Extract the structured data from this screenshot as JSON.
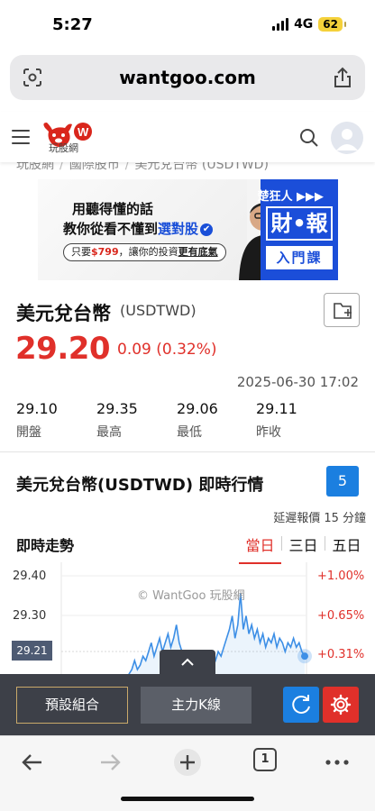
{
  "status_bar": {
    "time": "5:27",
    "network": "4G",
    "battery": "62"
  },
  "browser": {
    "url": "wantgoo.com",
    "tab_count": "1"
  },
  "site": {
    "logo_text": "玩股網"
  },
  "breadcrumb": [
    "玩股網",
    "國際股市",
    "美元兌台幣 (USDTWD)"
  ],
  "ad": {
    "line1": "用聽得懂的話",
    "line2_prefix": "教你從看不懂到",
    "line2_highlight": "選對股",
    "check_mark": "✔",
    "pill_prefix": "只要",
    "pill_price": "$799",
    "pill_middle": "，讓你的投資",
    "pill_highlight": "更有底氣",
    "brand": "楚狂人 ▶▶▶",
    "big_text": "財•報",
    "course_text": "入門課"
  },
  "quote": {
    "name": "美元兌台幣",
    "code": "(USDTWD)",
    "price": "29.20",
    "change": "0.09 (0.32%)",
    "timestamp": "2025-06-30 17:02",
    "stats": [
      {
        "value": "29.10",
        "label": "開盤"
      },
      {
        "value": "29.35",
        "label": "最高"
      },
      {
        "value": "29.06",
        "label": "最低"
      },
      {
        "value": "29.11",
        "label": "昨收"
      }
    ]
  },
  "realtime": {
    "title": "美元兌台幣(USDTWD) 即時行情",
    "badge": "5",
    "delay_note": "延遲報價 15 分鐘"
  },
  "chart_section": {
    "title": "即時走勢",
    "tabs": [
      "當日",
      "三日",
      "五日"
    ],
    "active_tab": "當日",
    "watermark": "© WantGoo 玩股網",
    "current_tag": "29.21"
  },
  "chart_data": {
    "type": "line",
    "y_ticks_left": [
      "29.40",
      "29.30",
      "29.21"
    ],
    "y_ticks_right": [
      "+1.00%",
      "+0.65%",
      "+0.31%"
    ],
    "ylim": [
      29.17,
      29.42
    ],
    "values": [
      29.16,
      29.17,
      29.18,
      29.2,
      29.18,
      29.19,
      29.21,
      29.2,
      29.22,
      29.24,
      29.21,
      29.23,
      29.25,
      29.22,
      29.24,
      29.26,
      29.23,
      29.25,
      29.28,
      29.24,
      29.22,
      29.2,
      29.21,
      29.19,
      29.18,
      29.17,
      29.19,
      29.2,
      29.18,
      29.17,
      29.19,
      29.21,
      29.2,
      29.22,
      29.21,
      29.23,
      29.25,
      29.27,
      29.3,
      29.25,
      29.28,
      29.35,
      29.27,
      29.3,
      29.26,
      29.28,
      29.25,
      29.27,
      29.24,
      29.26,
      29.23,
      29.25,
      29.24,
      29.26,
      29.23,
      29.25,
      29.24,
      29.22,
      29.24,
      29.23,
      29.25,
      29.23,
      29.24,
      29.22,
      29.21
    ]
  },
  "toolbar": {
    "preset_label": "預設組合",
    "k_label": "主力K線"
  },
  "colors": {
    "up": "#e0302a",
    "accent": "#1b7fe0",
    "line": "#3d8fe6",
    "toolbar": "#3d4048"
  }
}
